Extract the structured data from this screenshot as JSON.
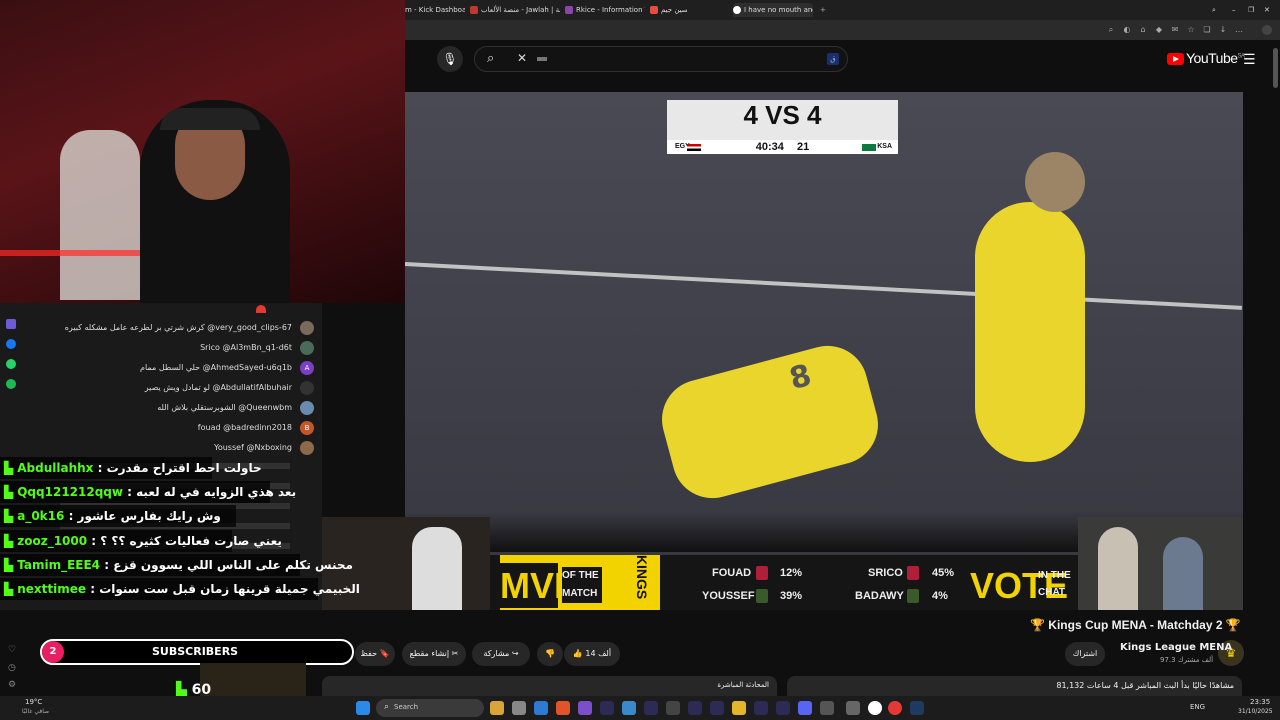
{
  "browser": {
    "tabs": [
      "m - Kick Dashboard",
      "منصة الألعاب - Jawlah | جولة",
      "Rkice - Information Techn",
      "سين جيم",
      "I have no mouth and I mu"
    ]
  },
  "youtube": {
    "logo": "YouTube",
    "region": "SA",
    "search_value": "",
    "video_title": "Kings Cup MENA - Matchday 2",
    "channel_name": "Kings League MENA",
    "subscribers": "97.3 ألف مشترك",
    "subscribe_label": "اشتراك",
    "likes": "14 ألف",
    "share_label": "مشاركة",
    "clip_label": "إنشاء مقطع",
    "save_label": "حفظ",
    "views": "81,132 مشاهدًا حاليًا بدأ البث المباشر قبل 4 ساعات",
    "live_chat_label": "المحادثة المباشرة"
  },
  "scoreboard": {
    "mode": "4 VS 4",
    "left_team": "EGY",
    "right_team": "KSA",
    "clock": "40:34",
    "period": "21"
  },
  "overlay": {
    "mvp": "MVP",
    "of_the_match": "OF THE MATCH",
    "kings": "KINGS",
    "player1": "FOUAD",
    "p1_pct": "12%",
    "player2": "YOUSSEF",
    "p2_pct": "39%",
    "player3": "SRICO",
    "p3_pct": "45%",
    "player4": "BADAWY",
    "p4_pct": "4%",
    "vote": "VOTE",
    "in_the_chat": "IN THE CHAT"
  },
  "yt_chat": [
    {
      "user": "@very_good_clips-67",
      "msg": "كرش شرتي بر لطرعه عامل مشكله كبيره"
    },
    {
      "user": "@Al3mBn_q1-d6t",
      "msg": "Srico"
    },
    {
      "user": "@AhmedSayed-u6q1b",
      "msg": "حلي السطل ممام",
      "initial": "A"
    },
    {
      "user": "@AbdullatifAlbuhair",
      "msg": "لو تمادل ويش يصير"
    },
    {
      "user": "@Queenwbm",
      "msg": "الشوبرستقلي بلاش الله"
    },
    {
      "user": "@badredinn2018",
      "msg": "fouad",
      "initial": "B"
    },
    {
      "user": "@Nxboxing",
      "msg": "Youssef"
    }
  ],
  "kick_chat": [
    {
      "user": "Abdullahhx",
      "msg": ": حاولت احط اقتراح مقدرت"
    },
    {
      "user": "Qqq121212qqw",
      "msg": ": بعد هذي الزوايه في له لعبه"
    },
    {
      "user": "a_0k16",
      "msg": ": وش رايك بفارس عاشور"
    },
    {
      "user": "zooz_1000",
      "msg": ": يعني صارت فعاليات كثيره ؟؟ ؟"
    },
    {
      "user": "Tamim_EEE4",
      "msg": ": محنس تكلم على الناس اللي يسوون قزع"
    },
    {
      "user": "nexttimee",
      "msg": ": الخبيمي جميلة قرينها زمان قبل ست سنوات"
    }
  ],
  "subs_widget": {
    "count": "2",
    "label": "SUBSCRIBERS",
    "viewers": "60"
  },
  "taskbar": {
    "weather": "19°C",
    "weather_desc": "صافي غالبًا",
    "search_placeholder": "Search",
    "lang": "ENG",
    "time": "23:35",
    "date": "31/10/2025"
  },
  "colors": {
    "kick_green": "#53fc18",
    "mvp_yellow": "#f2d300",
    "yt_red": "#ff0000"
  }
}
